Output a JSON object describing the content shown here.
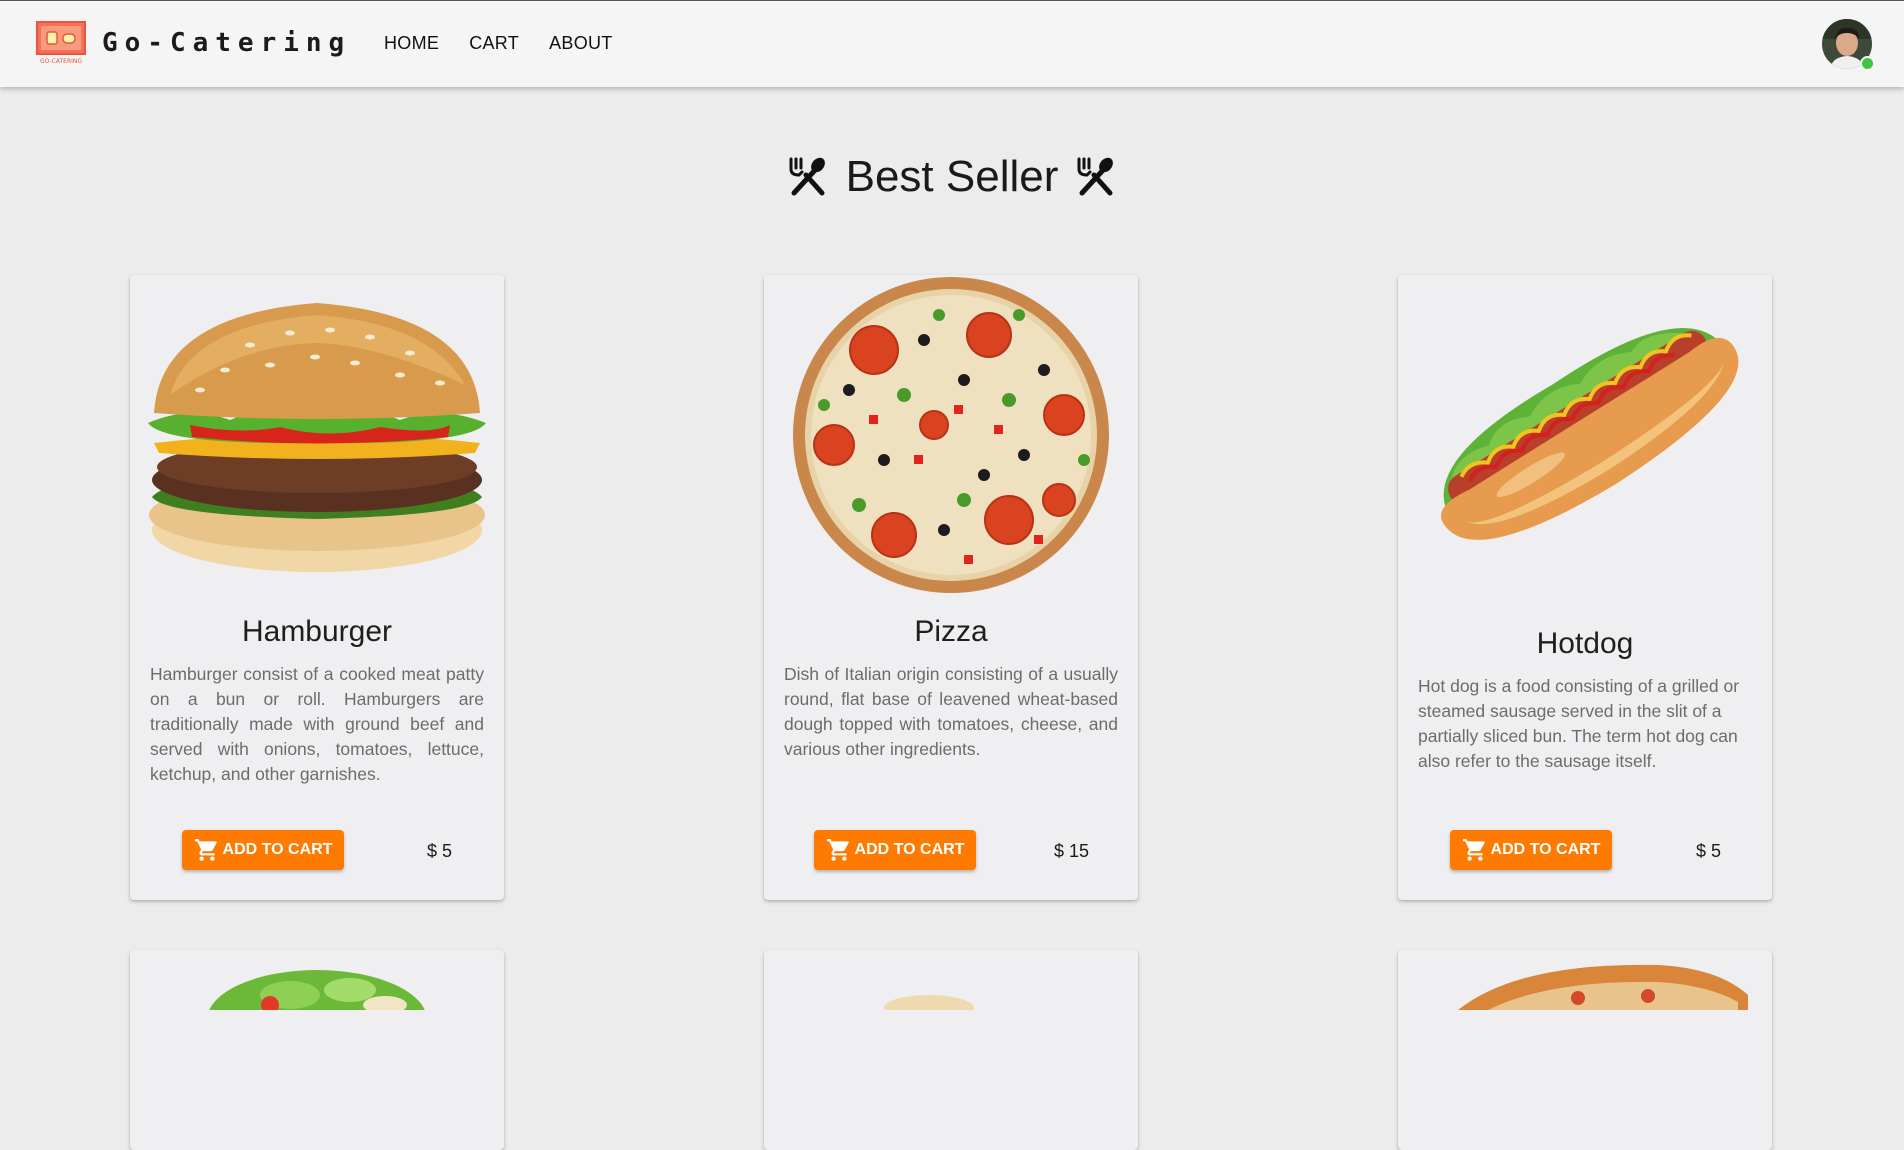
{
  "header": {
    "brand": "Go-Catering",
    "logo_text": "GO-CATERING",
    "nav": {
      "home": "HOME",
      "cart": "CART",
      "about": "ABOUT"
    },
    "status_color": "#43c343"
  },
  "section": {
    "title": "Best Seller",
    "icon": "fork-spoon-icon"
  },
  "products": [
    {
      "name": "Hamburger",
      "description": "Hamburger consist of a cooked meat patty on a bun or roll. Hamburgers are traditionally made with ground beef and served with onions, tomatoes, lettuce, ketchup, and other garnishes.",
      "button": "ADD TO CART",
      "price": "$ 5"
    },
    {
      "name": "Pizza",
      "description": "Dish of Italian origin consisting of a usually round, flat base of leavened wheat-based dough topped with tomatoes, cheese, and various other ingredients.",
      "button": "ADD TO CART",
      "price": "$ 15"
    },
    {
      "name": "Hotdog",
      "description": "Hot dog is a food consisting of a grilled or steamed sausage served in the slit of a partially sliced bun. The term hot dog can also refer to the sausage itself.",
      "button": "ADD TO CART",
      "price": "$ 5"
    }
  ],
  "colors": {
    "accent": "#ff7a00",
    "background": "#ececec",
    "card": "#efeff1"
  }
}
